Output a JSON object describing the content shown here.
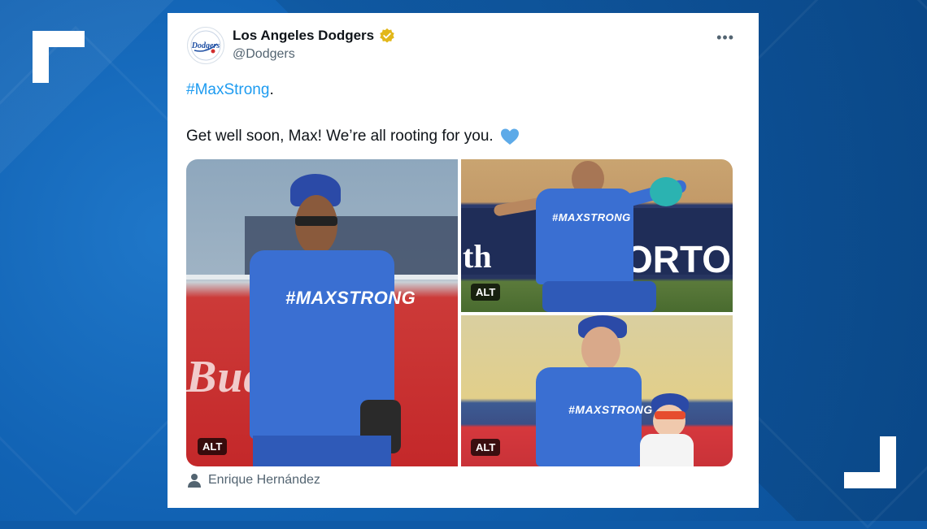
{
  "tweet": {
    "display_name": "Los Angeles Dodgers",
    "handle": "@Dodgers",
    "avatar_text": "Dodgers",
    "more_label": "•••",
    "hashtag": "#MaxStrong",
    "hashtag_suffix": ".",
    "body": "Get well soon, Max! We’re all rooting for you.",
    "verified_color": "#e2b719",
    "heart_color": "#5daae8"
  },
  "media": {
    "photos": [
      {
        "alt_badge": "ALT",
        "shirt_text": "#MAXSTRONG",
        "sign_text": "Budweiser"
      },
      {
        "alt_badge": "ALT",
        "shirt_text": "#MAXSTRONG",
        "sign_text": "ORTON",
        "sign_text_2": "th"
      },
      {
        "alt_badge": "ALT",
        "shirt_text": "#MAXSTRONG"
      }
    ]
  },
  "credit": {
    "icon": "person-icon",
    "name": "Enrique Hernández"
  },
  "colors": {
    "background": "#0f5aa7",
    "hashtag": "#1d9bf0",
    "text": "#0f1419",
    "secondary": "#536471"
  }
}
